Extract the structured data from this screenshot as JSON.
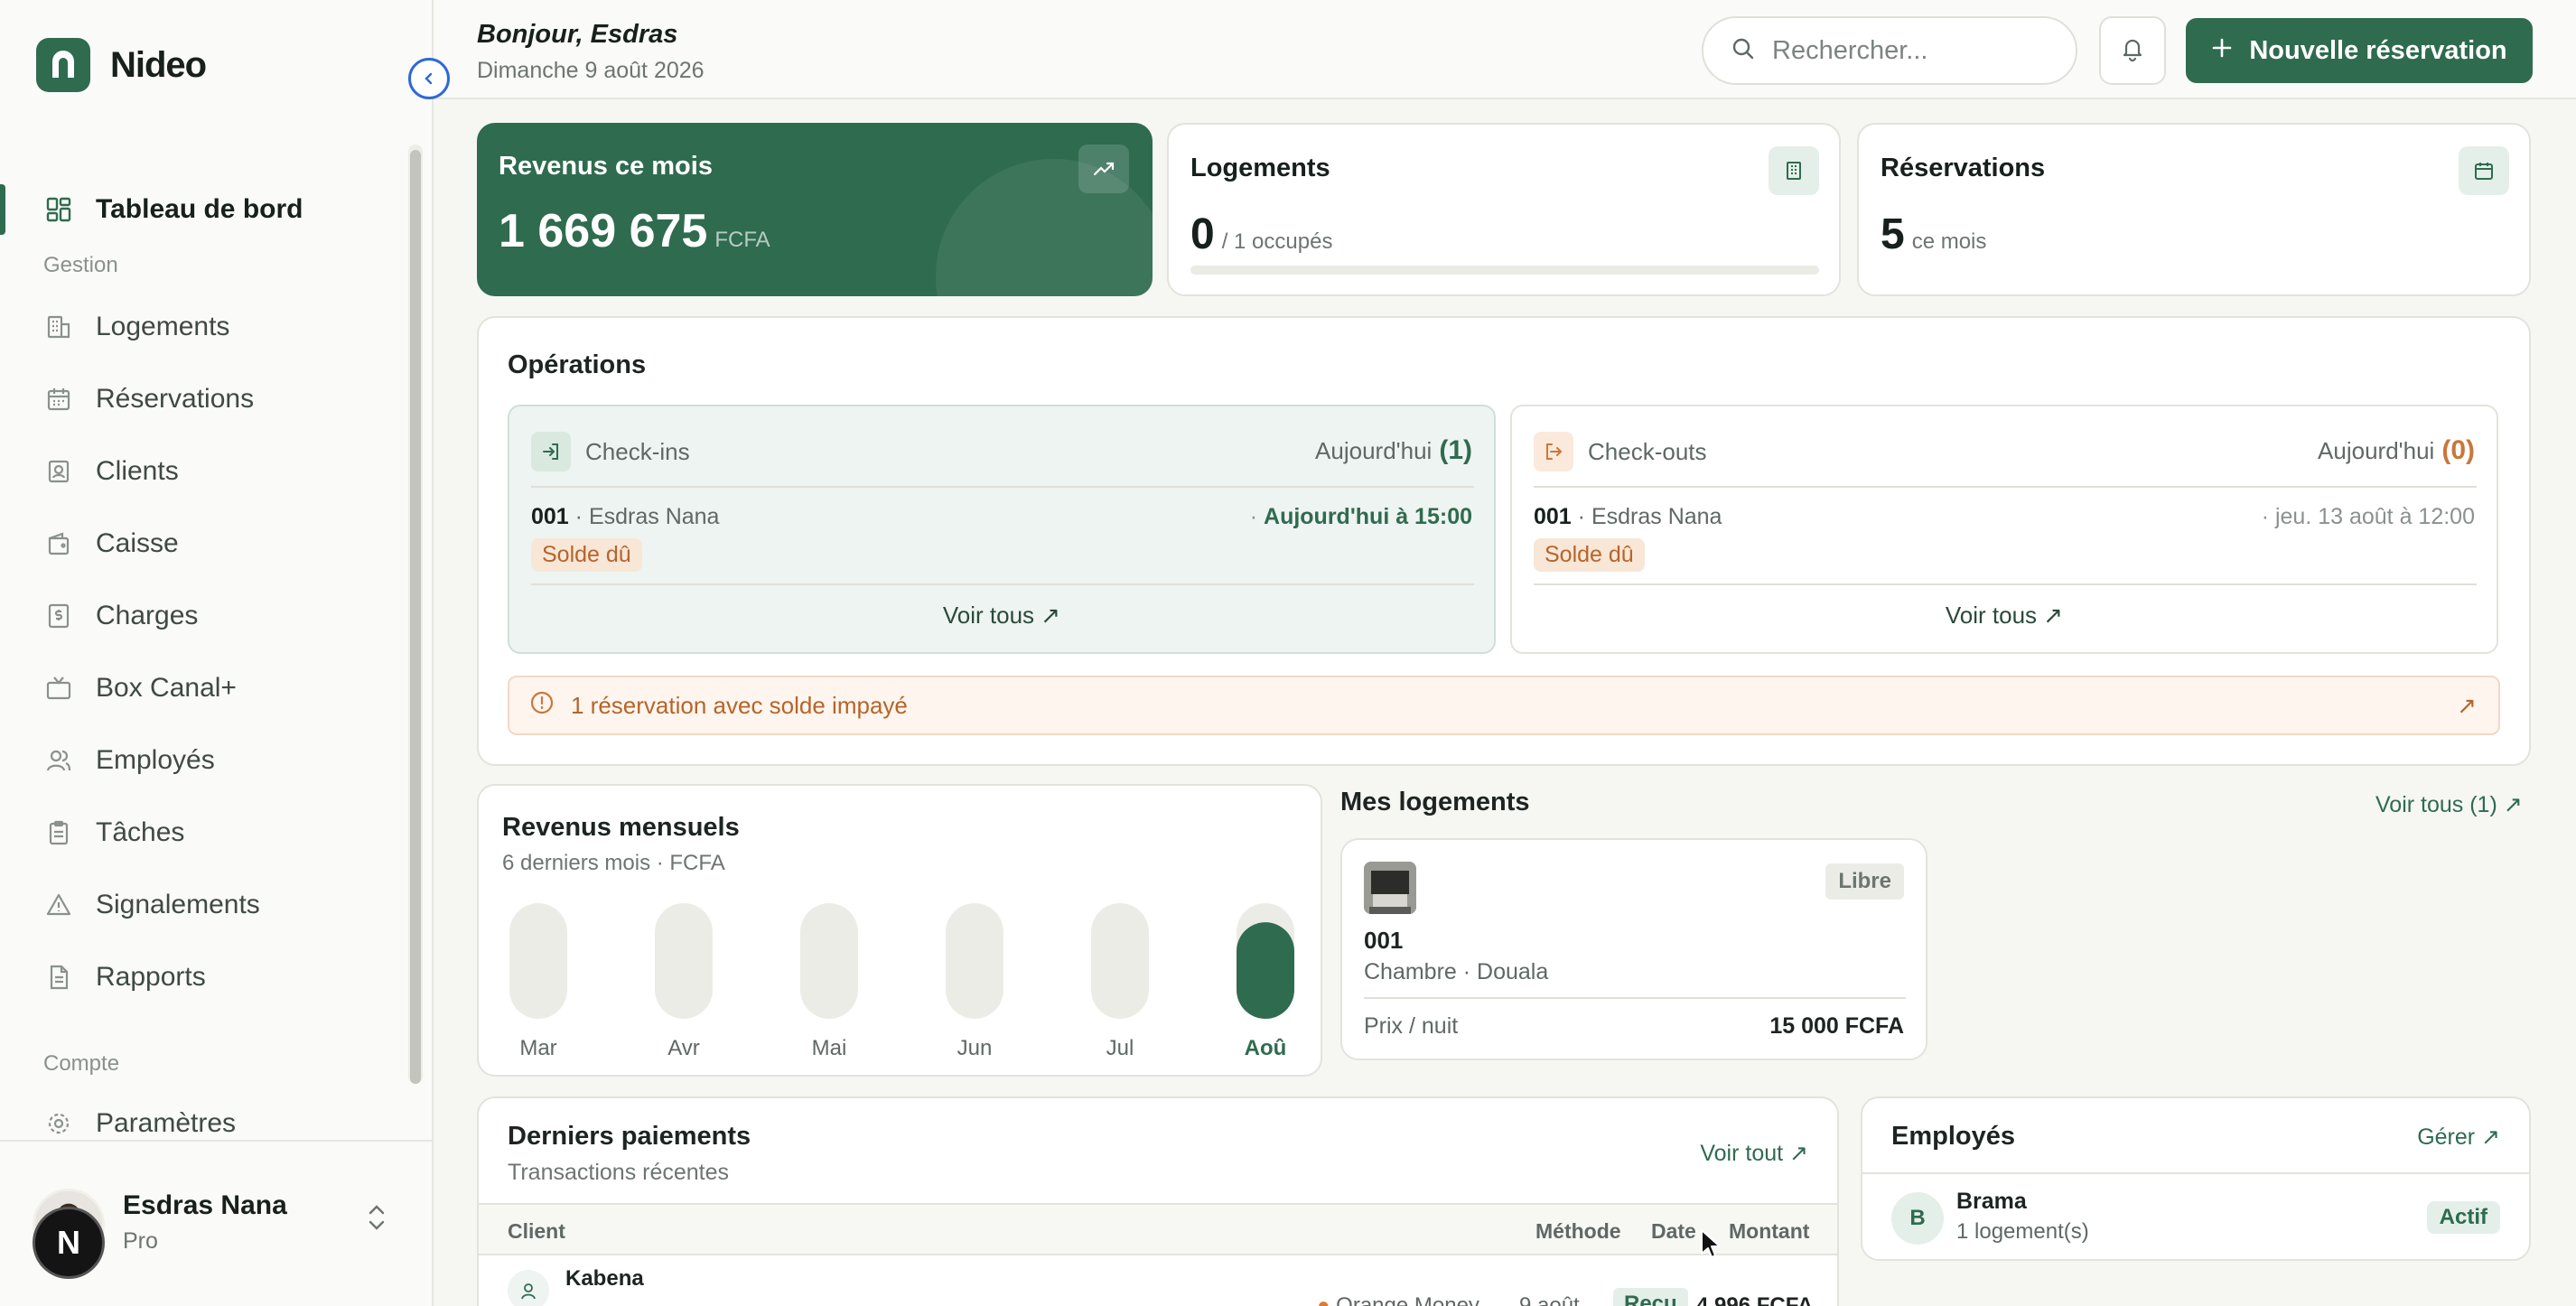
{
  "brand": {
    "name": "Nideo"
  },
  "sidebar": {
    "primary": {
      "label": "Tableau de bord",
      "icon": "dashboard-icon"
    },
    "sections": [
      {
        "title": "Gestion",
        "items": [
          {
            "label": "Logements",
            "icon": "building-icon"
          },
          {
            "label": "Réservations",
            "icon": "calendar-icon"
          },
          {
            "label": "Clients",
            "icon": "contact-icon"
          },
          {
            "label": "Caisse",
            "icon": "wallet-icon"
          },
          {
            "label": "Charges",
            "icon": "dollar-receipt-icon"
          },
          {
            "label": "Box Canal+",
            "icon": "tv-icon"
          },
          {
            "label": "Employés",
            "icon": "users-icon"
          },
          {
            "label": "Tâches",
            "icon": "clipboard-icon"
          },
          {
            "label": "Signalements",
            "icon": "warning-icon"
          },
          {
            "label": "Rapports",
            "icon": "file-icon"
          }
        ]
      },
      {
        "title": "Compte",
        "items": [
          {
            "label": "Paramètres",
            "icon": "gear-icon"
          }
        ]
      }
    ],
    "user": {
      "name": "Esdras Nana",
      "plan": "Pro",
      "badge": "N"
    }
  },
  "header": {
    "greeting": "Bonjour, Esdras",
    "date": "Dimanche 9 août 2026",
    "search_placeholder": "Rechercher...",
    "new_button": "Nouvelle réservation"
  },
  "kpis": {
    "revenue": {
      "title": "Revenus ce mois",
      "value": "1 669 675",
      "unit": "FCFA"
    },
    "logements": {
      "title": "Logements",
      "value": "0",
      "suffix": "/ 1 occupés",
      "occupancy": 0
    },
    "reservations": {
      "title": "Réservations",
      "value": "5",
      "suffix": "ce mois"
    }
  },
  "operations": {
    "title": "Opérations",
    "checkins": {
      "label": "Check-ins",
      "period": "Aujourd'hui",
      "count": "(1)",
      "row": {
        "code": "001",
        "guest": "Esdras Nana",
        "time": "Aujourd'hui à 15:00",
        "badge": "Solde dû"
      },
      "link": "Voir tous"
    },
    "checkouts": {
      "label": "Check-outs",
      "period": "Aujourd'hui",
      "count": "(0)",
      "row": {
        "code": "001",
        "guest": "Esdras Nana",
        "time": "jeu. 13 août à 12:00",
        "badge": "Solde dû"
      },
      "link": "Voir tous"
    },
    "alert": "1 réservation avec solde impayé"
  },
  "revenue_chart": {
    "title": "Revenus mensuels",
    "subtitle": "6 derniers mois · FCFA"
  },
  "chart_data": {
    "type": "bar",
    "categories": [
      "Mar",
      "Avr",
      "Mai",
      "Jun",
      "Jul",
      "Aoû"
    ],
    "values": [
      0,
      0,
      0,
      0,
      0,
      1669675
    ],
    "highlight_index": 5,
    "ylim": [
      0,
      2000000
    ],
    "colors": {
      "track": "#ecece7",
      "active": "#2f6b4f",
      "label": "#5f6864"
    }
  },
  "logements": {
    "title": "Mes logements",
    "link": "Voir tous (1)",
    "unit": {
      "status": "Libre",
      "code": "001",
      "location": "Chambre · Douala",
      "price_label": "Prix / nuit",
      "price": "15 000 FCFA"
    }
  },
  "payments": {
    "title": "Derniers paiements",
    "subtitle": "Transactions récentes",
    "link": "Voir tout",
    "columns": [
      "Client",
      "Méthode",
      "Date",
      "Montant"
    ],
    "rows": [
      {
        "client": "Kabena",
        "method": "Orange Money",
        "date": "9 août",
        "status": "Reçu",
        "amount": "4 996 FCFA"
      }
    ]
  },
  "employees": {
    "title": "Employés",
    "link": "Gérer",
    "items": [
      {
        "initial": "B",
        "name": "Brama",
        "sub": "1 logement(s)",
        "status": "Actif"
      }
    ]
  },
  "colors": {
    "brand": "#2f6b4f",
    "warning": "#b5652b"
  }
}
